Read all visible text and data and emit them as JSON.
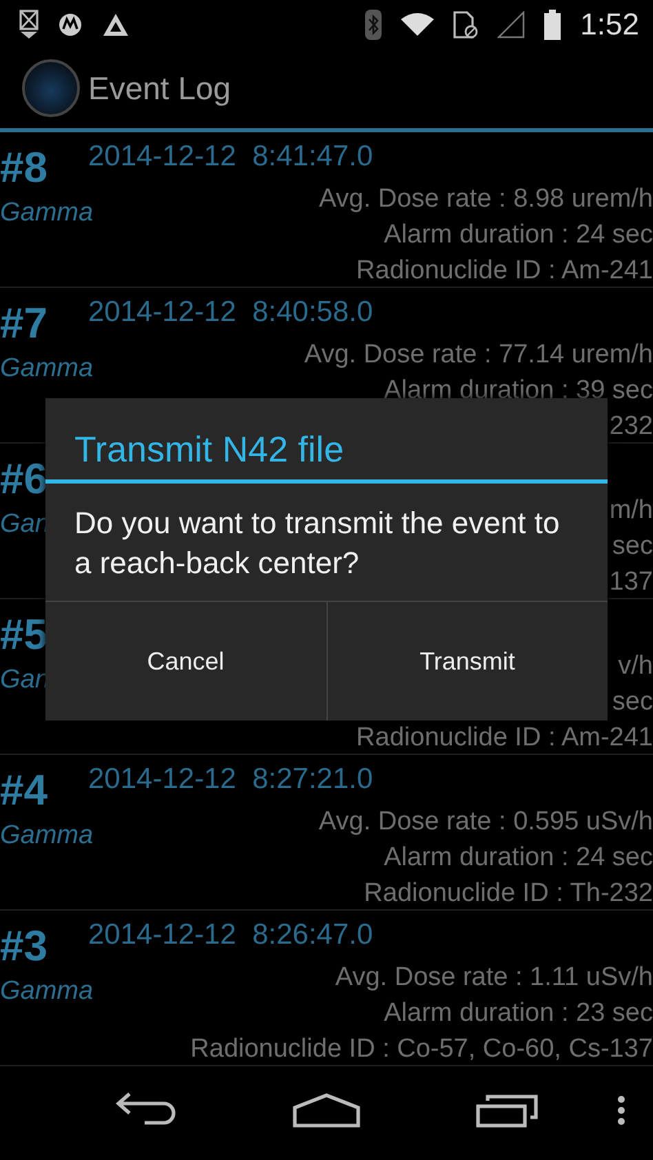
{
  "status_bar": {
    "time": "1:52"
  },
  "action_bar": {
    "title": "Event Log"
  },
  "events": [
    {
      "number": "#8",
      "type": "Gamma",
      "timestamp": "2014-12-12  8:41:47.0",
      "details": [
        "Avg. Dose rate : 8.98 urem/h",
        "Alarm duration : 24 sec",
        "Radionuclide ID : Am-241"
      ]
    },
    {
      "number": "#7",
      "type": "Gamma",
      "timestamp": "2014-12-12  8:40:58.0",
      "details": [
        "Avg. Dose rate : 77.14 urem/h",
        "Alarm duration : 39 sec",
        "232"
      ]
    },
    {
      "number": "#6",
      "type": "Gan",
      "details": [
        "m/h",
        "sec",
        "137"
      ]
    },
    {
      "number": "#5",
      "type": "Gan",
      "details": [
        "v/h",
        "sec",
        "Radionuclide ID : Am-241"
      ]
    },
    {
      "number": "#4",
      "type": "Gamma",
      "timestamp": "2014-12-12  8:27:21.0",
      "details": [
        "Avg. Dose rate : 0.595 uSv/h",
        "Alarm duration : 24 sec",
        "Radionuclide ID : Th-232"
      ]
    },
    {
      "number": "#3",
      "type": "Gamma",
      "timestamp": "2014-12-12  8:26:47.0",
      "details": [
        "Avg. Dose rate : 1.11 uSv/h",
        "Alarm duration : 23 sec",
        "Radionuclide ID : Co-57, Co-60, Cs-137"
      ]
    }
  ],
  "dialog": {
    "title": "Transmit N42 file",
    "message": "Do you want to transmit the event to a reach-back center?",
    "buttons": [
      "Cancel",
      "Transmit"
    ]
  }
}
